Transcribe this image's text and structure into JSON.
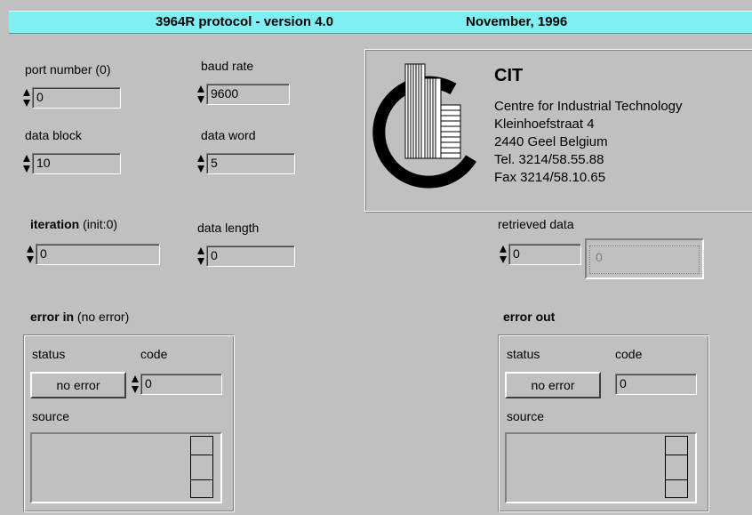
{
  "header": {
    "title": "3964R protocol - version 4.0",
    "date": "November, 1996"
  },
  "controls": {
    "port_number": {
      "label": "port number (0)",
      "value": "0"
    },
    "baud_rate": {
      "label": "baud rate",
      "value": "9600"
    },
    "data_block": {
      "label": "data block",
      "value": "10"
    },
    "data_word": {
      "label": "data word",
      "value": "5"
    },
    "iteration": {
      "label_bold": "iteration",
      "label_rest": "(init:0)",
      "value": "0"
    },
    "data_length": {
      "label": "data length",
      "value": "0"
    },
    "retrieved_data": {
      "label": "retrieved data",
      "index": "0",
      "value": "0"
    }
  },
  "logo": {
    "name": "CIT",
    "lines": [
      "Centre for Industrial Technology",
      "Kleinhoefstraat 4",
      "2440 Geel Belgium",
      "Tel. 3214/58.55.88",
      "Fax 3214/58.10.65"
    ]
  },
  "error_in": {
    "label_bold": "error in",
    "label_rest": "(no error)",
    "status_label": "status",
    "code_label": "code",
    "status_button": "no error",
    "code_value": "0",
    "source_label": "source"
  },
  "error_out": {
    "label_bold": "error out",
    "status_label": "status",
    "code_label": "code",
    "status_button": "no error",
    "code_value": "0",
    "source_label": "source"
  }
}
